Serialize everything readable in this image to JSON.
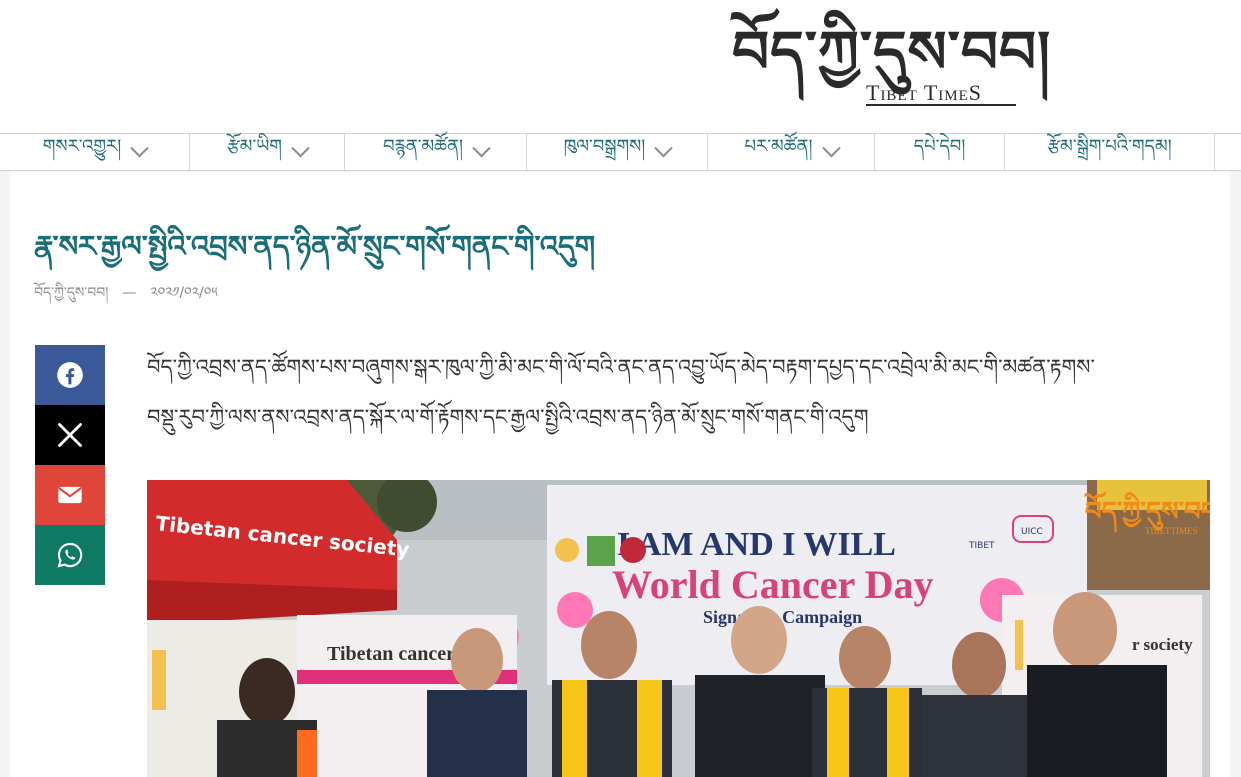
{
  "site": {
    "logo_tibetan": "བོད་ཀྱི་དུས་བབ།",
    "logo_english": "Tibet TimeS"
  },
  "nav": {
    "items": [
      {
        "label": "གསར་འགྱུར།",
        "has_dropdown": true
      },
      {
        "label": "རྩོམ་ཡིག",
        "has_dropdown": true
      },
      {
        "label": "བརྙན་མཚོན།",
        "has_dropdown": true
      },
      {
        "label": "ཁུལ་བསྒྲགས།",
        "has_dropdown": true
      },
      {
        "label": "པར་མཚོན།",
        "has_dropdown": true
      },
      {
        "label": "དཔེ་དེབ།",
        "has_dropdown": false
      },
      {
        "label": "རྩོམ་སྒྲིག་པའི་གདམ།",
        "has_dropdown": false
      }
    ]
  },
  "article": {
    "title": "རྣ་སར་རྒྱལ་སྤྱིའི་འབྲས་ནད་ཉིན་མོ་སྲུང་གསོ་གནང་གི་འདུག",
    "author": "བོད་ཀྱི་དུས་བབ།",
    "separator": "—",
    "date": "༢༠༢༡/༠༢/༠༥",
    "lead_line1": "བོད་ཀྱི་འབྲས་ནད་ཚོགས་པས་བཞུགས་སྒར་ཁུལ་ཀྱི་མི་མང་གི་ལོ་བའི་ནང་ནད་འབྱུ་ཡོད་མེད་བརྟག་དཔྱད་དང་འབྲེལ་མི་མང་གི་མཚན་རྟགས་",
    "lead_line2": "བསྡུ་རུབ་ཀྱི་ལས་ནས་འབྲས་ནད་སྐོར་ལ་གོ་རྟོགས་དང་རྒྱལ་སྤྱིའི་འབྲས་ནད་ཉིན་མོ་སྲུང་གསོ་གནང་གི་འདུག"
  },
  "share": {
    "buttons": [
      {
        "name": "facebook",
        "icon": "facebook-icon",
        "color": "#3b5998"
      },
      {
        "name": "x",
        "icon": "x-icon",
        "color": "#000000"
      },
      {
        "name": "email",
        "icon": "mail-icon",
        "color": "#e0453a"
      },
      {
        "name": "whatsapp",
        "icon": "whatsapp-icon",
        "color": "#0f7a64"
      }
    ]
  },
  "photo": {
    "banner_line1": "I AM AND I WILL",
    "banner_line2": "World Cancer Day",
    "banner_line3": "Signature Campaign",
    "tent_text": "Tibetan cancer society",
    "rollup_left_text": "Tibetan cancer",
    "rollup_right_text": "r society",
    "watermark": "བོད་ཀྱི་དུས་བབ།",
    "watermark_sub": "TIBETTIMES",
    "partner_logo_1": "TIBET",
    "partner_logo_2": "UICC"
  }
}
